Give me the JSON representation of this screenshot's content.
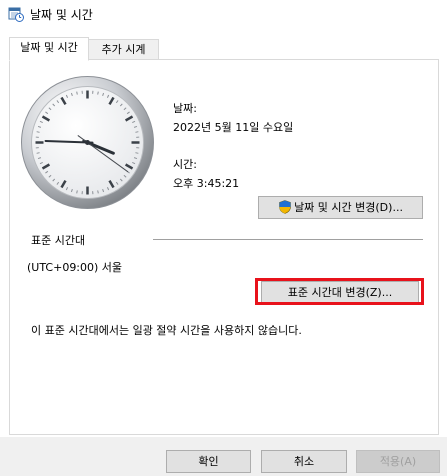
{
  "window": {
    "title": "날짜 및 시간",
    "icon": "calendar-clock-icon"
  },
  "tabs": [
    {
      "label": "날짜 및 시간",
      "active": true
    },
    {
      "label": "추가 시계",
      "active": false
    }
  ],
  "clock": {
    "hour": 3,
    "minute": 45,
    "second": 21
  },
  "date_section": {
    "date_label": "날짜:",
    "date_value": "2022년 5월 11일 수요일",
    "time_label": "시간:",
    "time_value": "오후 3:45:21",
    "change_button_label": "날짜 및 시간 변경(D)...",
    "change_button_icon": "uac-shield-icon"
  },
  "timezone_section": {
    "heading": "표준 시간대",
    "value": "(UTC+09:00) 서울",
    "change_button_label": "표준 시간대 변경(Z)...",
    "dst_note": "이 표준 시간대에서는 일광 절약 시간을 사용하지 않습니다."
  },
  "buttons": {
    "ok": "확인",
    "cancel": "취소",
    "apply": "적용(A)"
  },
  "colors": {
    "highlight_box": "#e8121b",
    "button_face": "#e1e1e1",
    "dialog_background": "#f0f0f0"
  }
}
